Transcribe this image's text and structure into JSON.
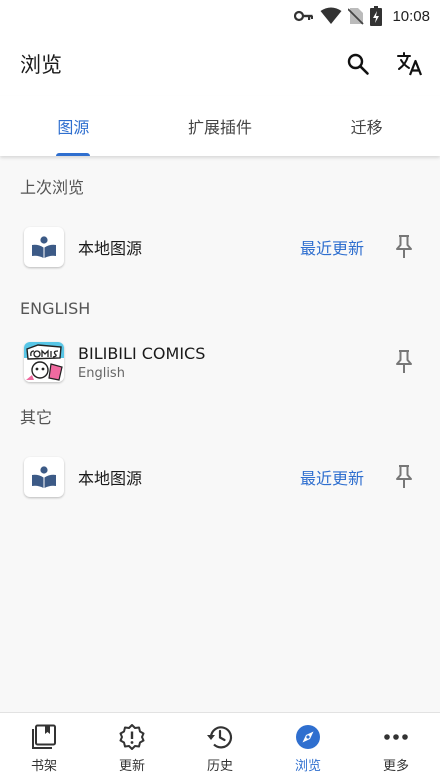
{
  "status_bar": {
    "time": "10:08"
  },
  "app_bar": {
    "title": "浏览",
    "actions": [
      "search-icon",
      "translate-icon"
    ]
  },
  "tabs": [
    {
      "label": "图源",
      "active": true
    },
    {
      "label": "扩展插件",
      "active": false
    },
    {
      "label": "迁移",
      "active": false
    }
  ],
  "sections": {
    "recent": {
      "header": "上次浏览",
      "item": {
        "name": "本地图源",
        "latest_label": "最近更新"
      }
    },
    "english": {
      "header": "ENGLISH",
      "item": {
        "name": "BILIBILI COMICS",
        "language": "English"
      }
    },
    "other": {
      "header": "其它",
      "item": {
        "name": "本地图源",
        "latest_label": "最近更新"
      }
    }
  },
  "bottom_nav": [
    {
      "label": "书架",
      "icon": "bookshelf-icon",
      "active": false
    },
    {
      "label": "更新",
      "icon": "alert-badge-icon",
      "active": false
    },
    {
      "label": "历史",
      "icon": "history-icon",
      "active": false
    },
    {
      "label": "浏览",
      "icon": "compass-icon",
      "active": true
    },
    {
      "label": "更多",
      "icon": "more-horiz-icon",
      "active": false
    }
  ],
  "colors": {
    "accent": "#2f6fcf",
    "background": "#f8f8f8"
  }
}
